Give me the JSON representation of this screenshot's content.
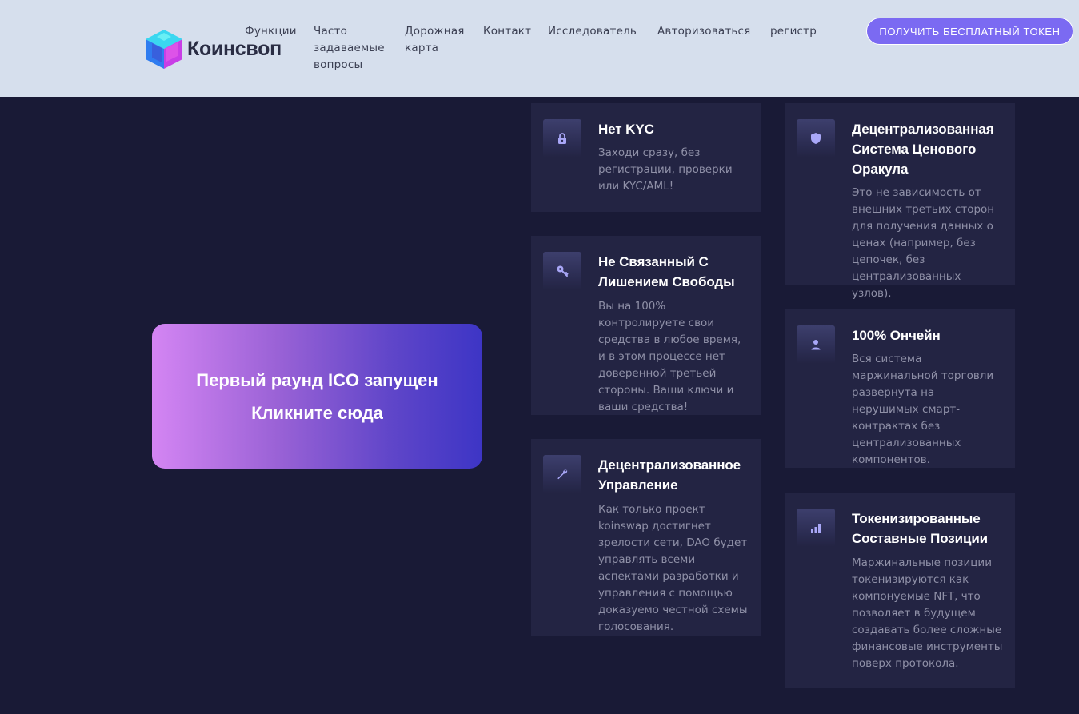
{
  "header": {
    "logo_text": "Коинсвоп",
    "nav": [
      {
        "label": "Функции"
      },
      {
        "label": "Часто задаваемые вопросы"
      },
      {
        "label": "Дорожная карта"
      },
      {
        "label": "Контакт"
      },
      {
        "label": "Исследователь"
      },
      {
        "label": "Авторизоваться"
      },
      {
        "label": "регистр"
      }
    ],
    "cta_label": "ПОЛУЧИТЬ БЕСПЛАТНЫЙ ТОКЕН"
  },
  "ico": {
    "line1": "Первый раунд ICO запущен",
    "line2": "Кликните сюда"
  },
  "features": [
    {
      "icon": "lock-icon",
      "title": "Нет KYC",
      "desc": "Заходи сразу, без регистрации, проверки или KYC/AML!"
    },
    {
      "icon": "shield-icon",
      "title": "Децентрализованная Система Ценового Оракула",
      "desc": "Это не зависимость от внешних третьих сторон для получения данных о ценах (например, без цепочек, без централизованных узлов)."
    },
    {
      "icon": "key-icon",
      "title": "Не Связанный С Лишением Свободы",
      "desc": "Вы на 100% контролируете свои средства в любое время, и в этом процессе нет доверенной третьей стороны. Ваши ключи и ваши средства!"
    },
    {
      "icon": "user-icon",
      "title": "100% Ончейн",
      "desc": "Вся система маржинальной торговли развернута на нерушимых смарт-контрактах без централизованных компонентов."
    },
    {
      "icon": "wrench-icon",
      "title": "Децентрализованное Управление",
      "desc": "Как только проект koinswap достигнет зрелости сети, DAO будет управлять всеми аспектами разработки и управления с помощью доказуемо честной схемы голосования."
    },
    {
      "icon": "bar-chart-icon",
      "title": "Токенизированные Составные Позиции",
      "desc": "Маржинальные позиции токенизируются как компонуемые NFT, что позволяет в будущем создавать более сложные финансовые инструменты поверх протокола."
    }
  ],
  "colors": {
    "background": "#191a36",
    "header": "#d6dfed",
    "card": "#232443",
    "accent": "#7b6af2",
    "icon": "#a9a7f7"
  }
}
